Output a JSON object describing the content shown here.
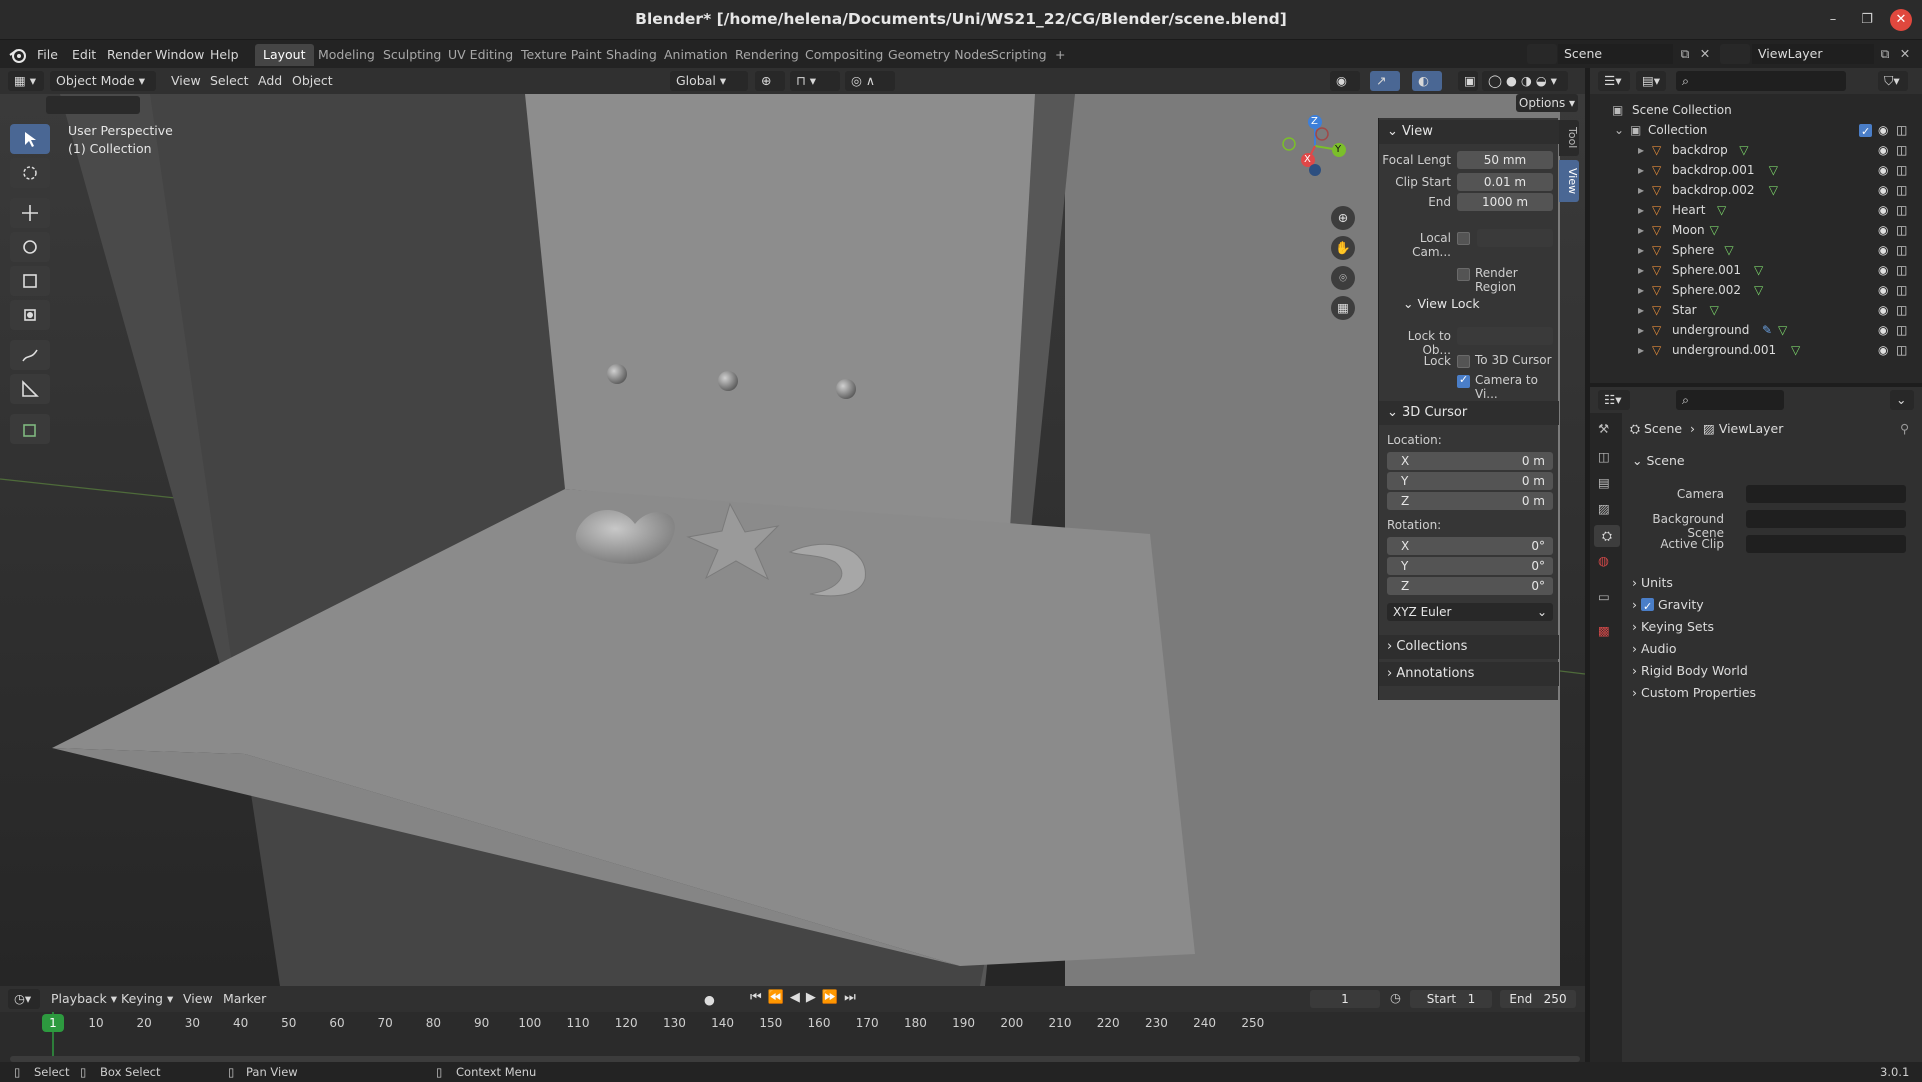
{
  "window": {
    "title": "Blender* [/home/helena/Documents/Uni/WS21_22/CG/Blender/scene.blend]"
  },
  "menu": {
    "file": "File",
    "edit": "Edit",
    "render": "Render",
    "window": "Window",
    "help": "Help"
  },
  "workspaces": [
    "Layout",
    "Modeling",
    "Sculpting",
    "UV Editing",
    "Texture Paint",
    "Shading",
    "Animation",
    "Rendering",
    "Compositing",
    "Geometry Nodes",
    "Scripting"
  ],
  "scene_selector": {
    "scene": "Scene",
    "view_layer": "ViewLayer"
  },
  "viewport_header": {
    "mode": "Object Mode",
    "view": "View",
    "select": "Select",
    "add": "Add",
    "object": "Object",
    "orientation": "Global",
    "options": "Options"
  },
  "viewport": {
    "perspective": "User Perspective",
    "collection": "(1) Collection"
  },
  "gizmo": {
    "x": "X",
    "y": "Y",
    "z": "Z"
  },
  "npanel": {
    "view_title": "View",
    "focal_label": "Focal Lengt",
    "focal_value": "50 mm",
    "clip_start_label": "Clip Start",
    "clip_start_value": "0.01 m",
    "end_label": "End",
    "end_value": "1000 m",
    "local_cam_label": "Local Cam...",
    "render_region": "Render Region",
    "view_lock_title": "View Lock",
    "lock_to_obj_label": "Lock to Ob...",
    "lock_label": "Lock",
    "to_3d_cursor": "To 3D Cursor",
    "camera_to_view": "Camera to Vi...",
    "cursor_title": "3D Cursor",
    "location_label": "Location:",
    "loc_x": "0 m",
    "loc_y": "0 m",
    "loc_z": "0 m",
    "rotation_label": "Rotation:",
    "rot_x": "0°",
    "rot_y": "0°",
    "rot_z": "0°",
    "x": "X",
    "y": "Y",
    "z": "Z",
    "rotation_mode": "XYZ Euler",
    "collections": "Collections",
    "annotations": "Annotations",
    "tab_tool": "Tool",
    "tab_view": "View"
  },
  "outliner": {
    "scene_collection": "Scene Collection",
    "collection": "Collection",
    "items": [
      "backdrop",
      "backdrop.001",
      "backdrop.002",
      "Heart",
      "Moon",
      "Sphere",
      "Sphere.001",
      "Sphere.002",
      "Star",
      "underground",
      "underground.001"
    ]
  },
  "properties": {
    "breadcrumb_scene": "Scene",
    "breadcrumb_viewlayer": "ViewLayer",
    "scene_title": "Scene",
    "camera_label": "Camera",
    "background_scene_label": "Background Scene",
    "active_clip_label": "Active Clip",
    "sections": [
      "Units",
      "Gravity",
      "Keying Sets",
      "Audio",
      "Rigid Body World",
      "Custom Properties"
    ]
  },
  "timeline": {
    "playback": "Playback",
    "keying": "Keying",
    "view": "View",
    "marker": "Marker",
    "current_frame": "1",
    "start_label": "Start",
    "start_value": "1",
    "end_label": "End",
    "end_value": "250",
    "ticks": [
      "10",
      "20",
      "30",
      "40",
      "50",
      "60",
      "70",
      "80",
      "90",
      "100",
      "110",
      "120",
      "130",
      "140",
      "150",
      "160",
      "170",
      "180",
      "190",
      "200",
      "210",
      "220",
      "230",
      "240",
      "250"
    ],
    "playhead": "1"
  },
  "statusbar": {
    "select": "Select",
    "box_select": "Box Select",
    "pan_view": "Pan View",
    "context_menu": "Context Menu",
    "version": "3.0.1"
  }
}
